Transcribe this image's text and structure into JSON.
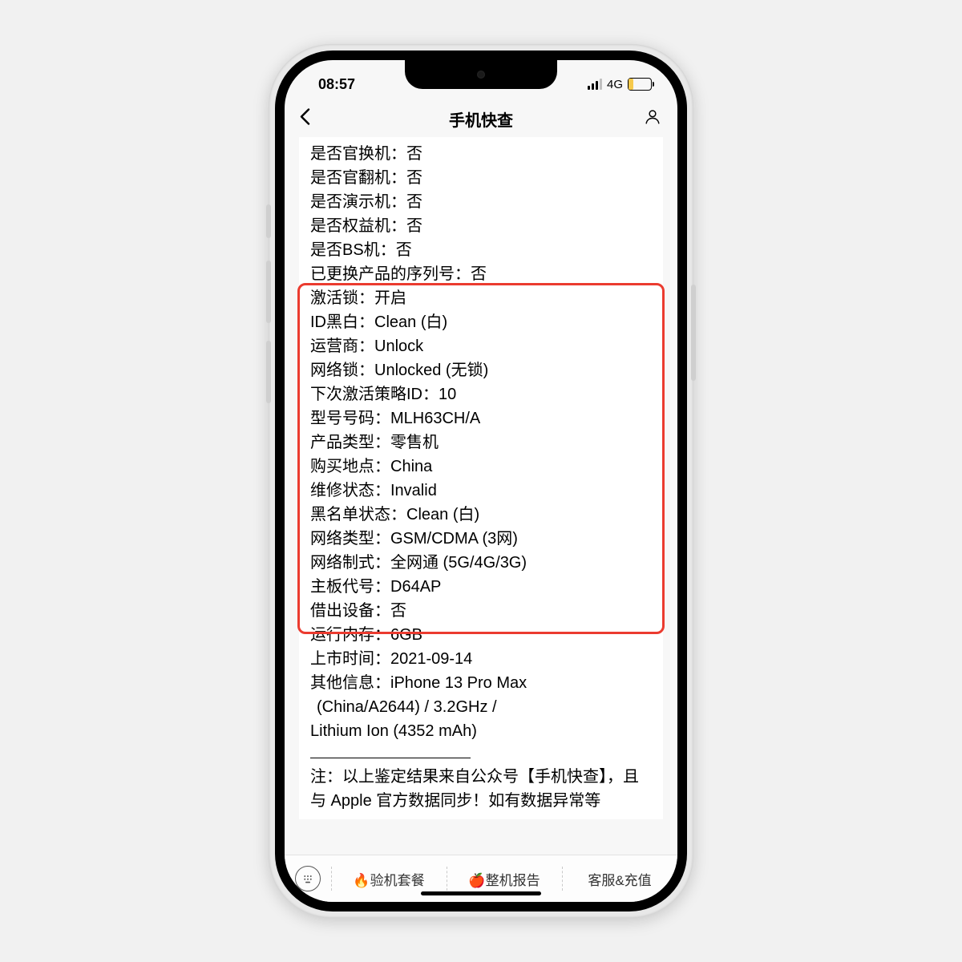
{
  "statusbar": {
    "time": "08:57",
    "network": "4G"
  },
  "nav": {
    "title": "手机快查"
  },
  "top_rows": [
    {
      "label": "是否官换机",
      "value": "否"
    },
    {
      "label": "是否官翻机",
      "value": "否"
    },
    {
      "label": "是否演示机",
      "value": "否"
    },
    {
      "label": "是否权益机",
      "value": "否"
    },
    {
      "label": "是否BS机",
      "value": "否"
    },
    {
      "label": "已更换产品的序列号",
      "value": "否"
    }
  ],
  "boxed_rows": [
    {
      "label": "激活锁",
      "value": "开启"
    },
    {
      "label": "ID黑白",
      "value": "Clean (白)"
    },
    {
      "label": "运营商",
      "value": "Unlock"
    },
    {
      "label": "网络锁",
      "value": "Unlocked (无锁)"
    },
    {
      "label": "下次激活策略ID",
      "value": "10"
    },
    {
      "label": "型号号码",
      "value": "MLH63CH/A"
    },
    {
      "label": "产品类型",
      "value": "零售机"
    },
    {
      "label": "购买地点",
      "value": "China"
    },
    {
      "label": "维修状态",
      "value": "Invalid"
    },
    {
      "label": "黑名单状态",
      "value": "Clean (白)"
    },
    {
      "label": "网络类型",
      "value": "GSM/CDMA (3网)"
    },
    {
      "label": "网络制式",
      "value": "全网通 (5G/4G/3G)"
    },
    {
      "label": "主板代号",
      "value": "D64AP"
    },
    {
      "label": "借出设备",
      "value": "否"
    },
    {
      "label": "运行内存",
      "value": "6GB"
    }
  ],
  "after_rows": [
    {
      "label": "上市时间",
      "value": "2021-09-14"
    }
  ],
  "other_info": {
    "label": "其他信息",
    "line1": "iPhone 13 Pro Max",
    "line2": "(China/A2644) / 3.2GHz /",
    "line3": "Lithium Ion (4352 mAh)"
  },
  "note": {
    "prefix": "注：",
    "text": "以上鉴定结果来自公众号【手机快查】，且与 Apple 官方数据同步！如有数据异常等"
  },
  "tabs": {
    "t1": "🔥验机套餐",
    "t2": "🍎整机报告",
    "t3": "客服&充值"
  }
}
